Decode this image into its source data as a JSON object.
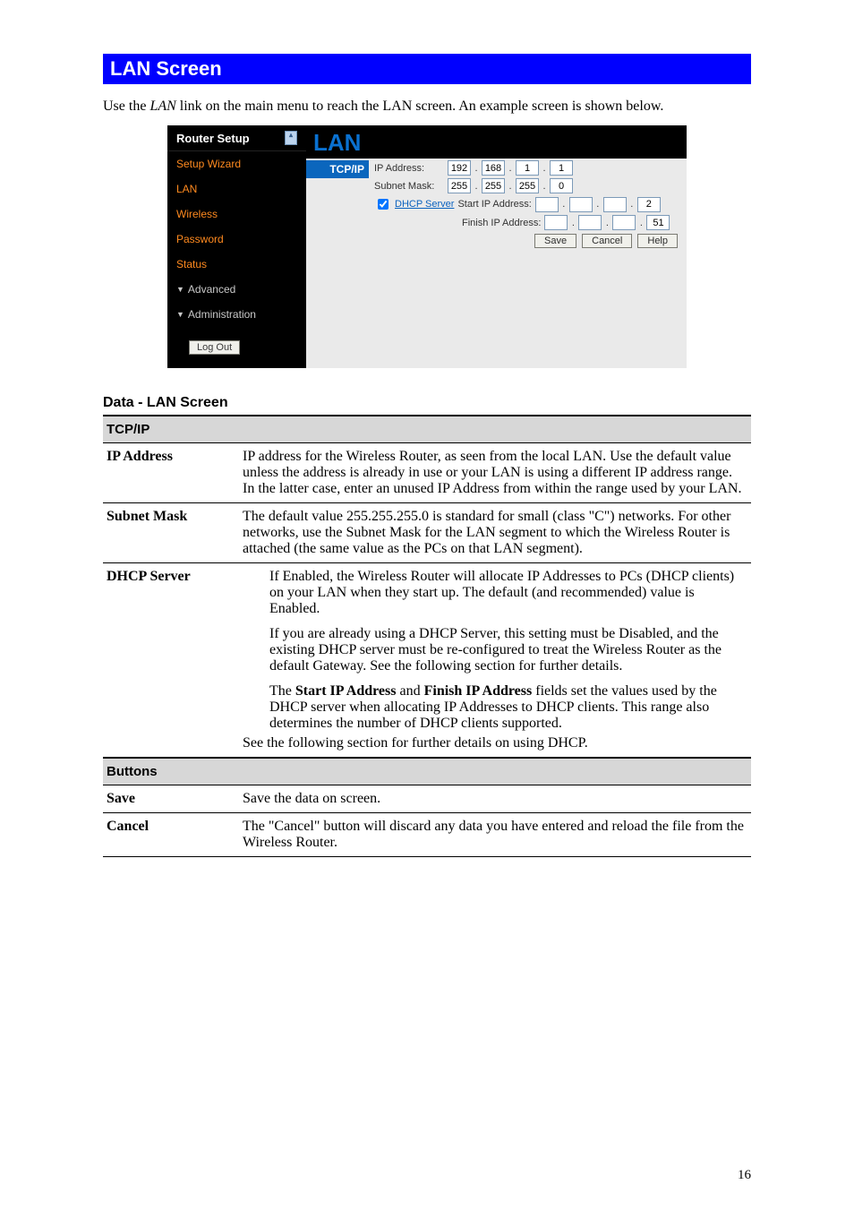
{
  "section_title": "LAN Screen",
  "intro_prefix": "Use the ",
  "intro_em": "LAN",
  "intro_suffix": " link on the main menu to reach the LAN screen. An example screen is shown below.",
  "router": {
    "sidebar_title": "Router Setup",
    "nav": [
      "Setup Wizard",
      "LAN",
      "Wireless",
      "Password",
      "Status",
      "Advanced",
      "Administration"
    ],
    "logout": "Log Out",
    "panel_heading": "LAN",
    "tab": "TCP/IP",
    "labels": {
      "ip_address": "IP Address:",
      "subnet_mask": "Subnet Mask:",
      "dhcp_server": "DHCP Server",
      "start_ip": "Start IP Address:",
      "finish_ip": "Finish IP Address:"
    },
    "ip": [
      "192",
      "168",
      "1",
      "1"
    ],
    "mask": [
      "255",
      "255",
      "255",
      "0"
    ],
    "start": [
      "",
      "",
      "",
      "2"
    ],
    "finish": [
      "",
      "",
      "",
      "51"
    ],
    "buttons": {
      "save": "Save",
      "cancel": "Cancel",
      "help": "Help"
    }
  },
  "data_heading": "Data - LAN Screen",
  "table": {
    "tcpip": "TCP/IP",
    "ip_address": {
      "label": "IP Address",
      "text": "IP address for the Wireless Router, as seen from the local LAN. Use the default value unless the address is already in use or your LAN is using a different IP address range. In the latter case, enter an unused IP Address from within the range used by your LAN."
    },
    "subnet_mask": {
      "label": "Subnet Mask",
      "text": "The default value 255.255.255.0 is standard for small (class \"C\") networks. For other networks, use the Subnet Mask for the LAN segment to which the Wireless Router is attached (the same value as the PCs on that LAN segment)."
    },
    "dhcp_server": {
      "label": "DHCP Server",
      "p1": "If Enabled, the Wireless Router will allocate IP Addresses to PCs (DHCP clients) on your LAN when they start up. The default (and recommended) value is Enabled.",
      "p2": "If you are already using a DHCP Server, this setting must be Disabled, and the existing DHCP server must be re-configured to treat the Wireless Router as the default Gateway. See the following section for further details.",
      "p3_pre": "The ",
      "p3_b1": "Start IP Address",
      "p3_mid": " and ",
      "p3_b2": "Finish IP Address",
      "p3_post": " fields set the values used by the DHCP server when allocating IP Addresses to DHCP clients. This range also determines the number of DHCP clients supported.",
      "trailing": "See the following section for further details on using DHCP."
    },
    "buttons": "Buttons",
    "save": {
      "label": "Save",
      "text": "Save the data on screen."
    },
    "cancel": {
      "label": "Cancel",
      "text": "The \"Cancel\" button will discard any data you have entered and reload the file from the Wireless Router."
    }
  },
  "page_number": "16"
}
